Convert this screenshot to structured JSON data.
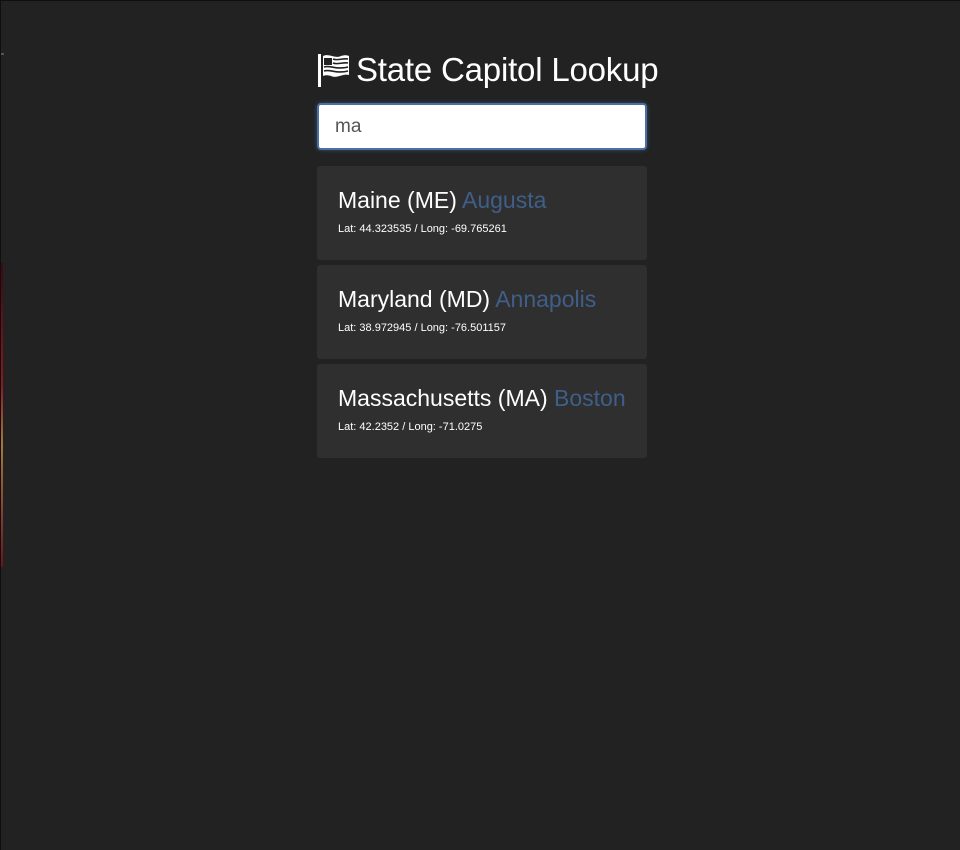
{
  "header": {
    "title": "State Capitol Lookup",
    "icon": "flag-icon"
  },
  "search": {
    "value": "ma"
  },
  "colors": {
    "background": "#222222",
    "card_background": "#2f2f2f",
    "capital_accent": "#3f5f8a",
    "input_focus_border": "#4a6fa0"
  },
  "results": [
    {
      "state": "Maine",
      "abbr": "(ME)",
      "capital": "Augusta",
      "coords": "Lat: 44.323535 / Long: -69.765261"
    },
    {
      "state": "Maryland",
      "abbr": "(MD)",
      "capital": "Annapolis",
      "coords": "Lat: 38.972945 / Long: -76.501157"
    },
    {
      "state": "Massachusetts",
      "abbr": "(MA)",
      "capital": "Boston",
      "coords": "Lat: 42.2352 / Long: -71.0275"
    }
  ]
}
